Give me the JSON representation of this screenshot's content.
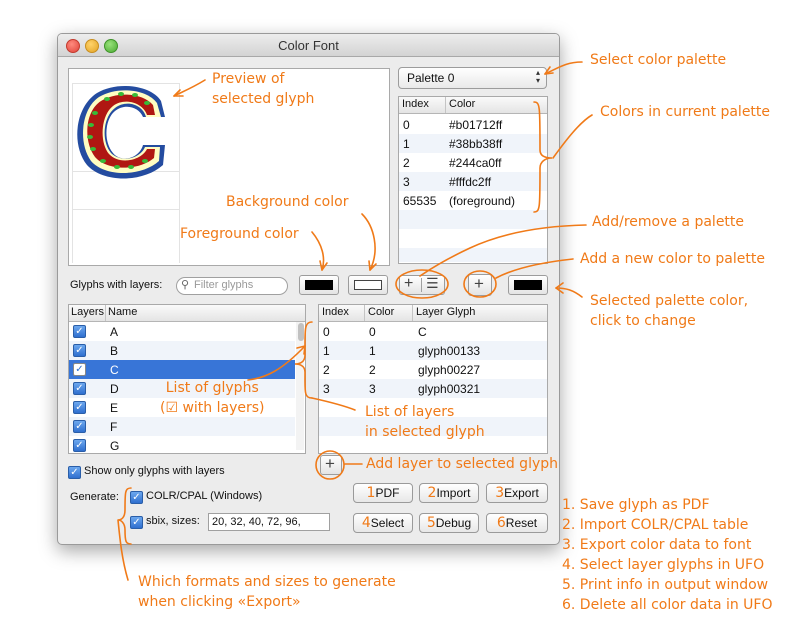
{
  "window": {
    "title": "Color Font"
  },
  "palette_popup": {
    "value": "Palette 0",
    "arrows": "▲▼"
  },
  "palette_table": {
    "headers": [
      "Index",
      "Color"
    ],
    "rows": [
      {
        "index": "0",
        "color": "#b01712ff"
      },
      {
        "index": "1",
        "color": "#38bb38ff"
      },
      {
        "index": "2",
        "color": "#244ca0ff"
      },
      {
        "index": "3",
        "color": "#fffdc2ff"
      },
      {
        "index": "65535",
        "color": "(foreground)"
      }
    ]
  },
  "preview": {
    "glyph_char": "C"
  },
  "glyphs_label": "Glyphs with layers:",
  "search": {
    "placeholder": "Filter glyphs",
    "icon": "search-icon"
  },
  "swatches": {
    "foreground": "#000000",
    "background": "#ffffff",
    "selected_palette_color": "#000000"
  },
  "glyph_table": {
    "headers": [
      "Layers",
      "Name"
    ],
    "rows": [
      {
        "checked": true,
        "name": "A"
      },
      {
        "checked": true,
        "name": "B"
      },
      {
        "checked": true,
        "name": "C",
        "selected": true
      },
      {
        "checked": true,
        "name": "D"
      },
      {
        "checked": true,
        "name": "E"
      },
      {
        "checked": true,
        "name": "F"
      },
      {
        "checked": true,
        "name": "G"
      }
    ]
  },
  "layer_table": {
    "headers": [
      "Index",
      "Color",
      "Layer Glyph"
    ],
    "rows": [
      {
        "index": "0",
        "color": "0",
        "glyph": "C"
      },
      {
        "index": "1",
        "color": "1",
        "glyph": "glyph00133"
      },
      {
        "index": "2",
        "color": "2",
        "glyph": "glyph00227"
      },
      {
        "index": "3",
        "color": "3",
        "glyph": "glyph00321"
      }
    ]
  },
  "options": {
    "show_only_layers": "Show only glyphs with layers",
    "generate_label": "Generate:",
    "colr_cpal": "COLR/CPAL (Windows)",
    "sbix": "sbix, sizes:",
    "sbix_sizes": "20, 32, 40, 72, 96,"
  },
  "buttons": {
    "pdf": "PDF",
    "import": "Import",
    "export": "Export",
    "select": "Select",
    "debug": "Debug",
    "reset": "Reset",
    "plus": "+",
    "minus_icon": "–"
  },
  "annotations": {
    "preview": "Preview of\nselected glyph",
    "select_palette": "Select color palette",
    "colors_in_palette": "Colors in current palette",
    "background_color": "Background color",
    "foreground_color": "Foreground color",
    "add_remove_palette": "Add/remove a palette",
    "add_color": "Add a new color to palette",
    "selected_palette_color": "Selected palette color,\nclick to change",
    "list_of_glyphs": "List of glyphs\n(☑ with layers)",
    "list_of_layers": "List of layers\nin selected glyph",
    "add_layer": "Add layer to selected glyph",
    "formats": "Which formats and sizes to generate\nwhen clicking «Export»",
    "steps": [
      "1. Save glyph as PDF",
      "2. Import COLR/CPAL table",
      "3. Export color data to font",
      "4. Select layer glyphs in UFO",
      "5. Print info in output window",
      "6. Delete all color data in UFO"
    ],
    "button_numbers": [
      "1",
      "2",
      "3",
      "4",
      "5",
      "6"
    ]
  },
  "colors": {
    "annotation": "#f07a18",
    "selection": "#3875d7",
    "glyph_red": "#b01712",
    "glyph_green": "#38bb38",
    "glyph_blue": "#244ca0",
    "glyph_cream": "#fffdc2"
  }
}
